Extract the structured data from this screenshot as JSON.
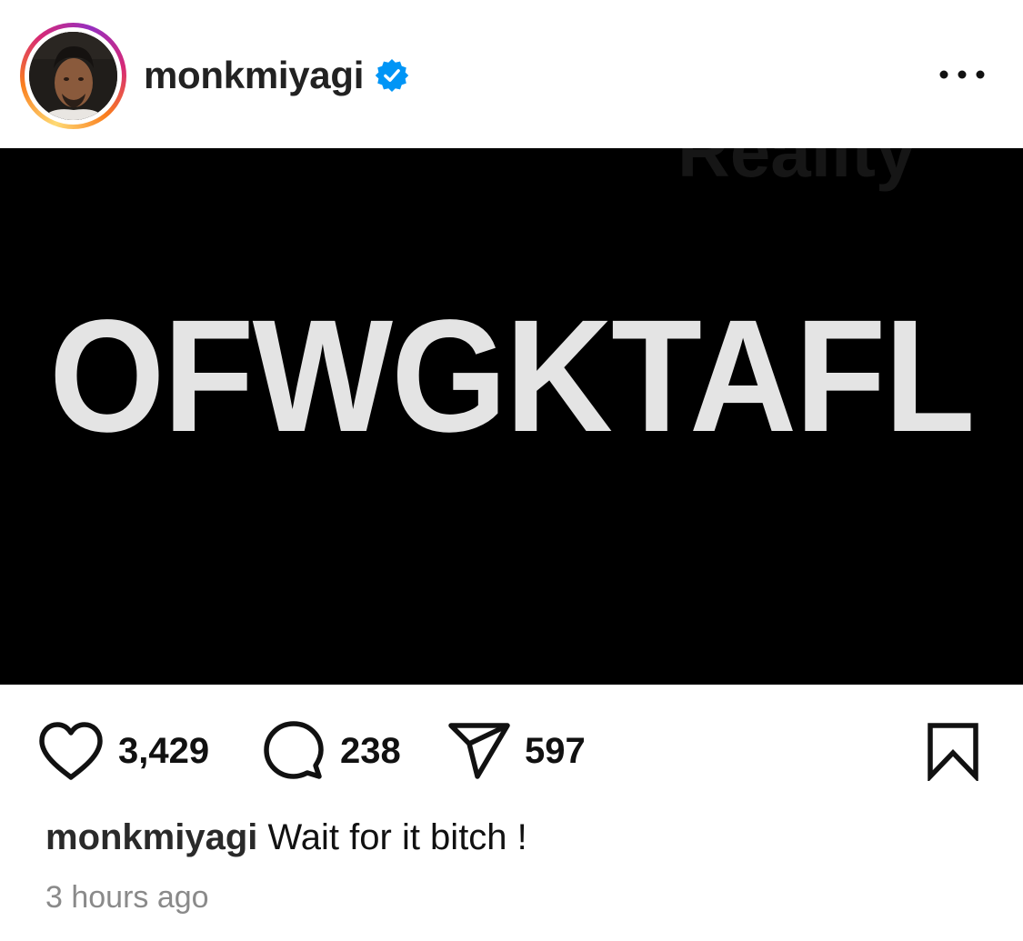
{
  "post": {
    "author": {
      "username": "monkmiyagi",
      "verified": true,
      "avatar_icon": "profile-photo"
    },
    "header": {
      "more_icon": "more-horizontal-icon"
    },
    "image": {
      "text": "OFWGKTAFL",
      "ghost_text": "Reality",
      "background": "#000000",
      "text_color": "#e4e4e4"
    },
    "actions": {
      "likes": "3,429",
      "comments": "238",
      "shares": "597",
      "like_icon": "heart-icon",
      "comment_icon": "comment-bubble-icon",
      "share_icon": "paper-plane-icon",
      "save_icon": "bookmark-icon"
    },
    "caption": {
      "username": "monkmiyagi",
      "text": " Wait for it bitch !"
    },
    "timestamp": "3 hours ago"
  },
  "colors": {
    "verified_badge": "#0095f6",
    "muted_text": "#8a8a8a"
  }
}
